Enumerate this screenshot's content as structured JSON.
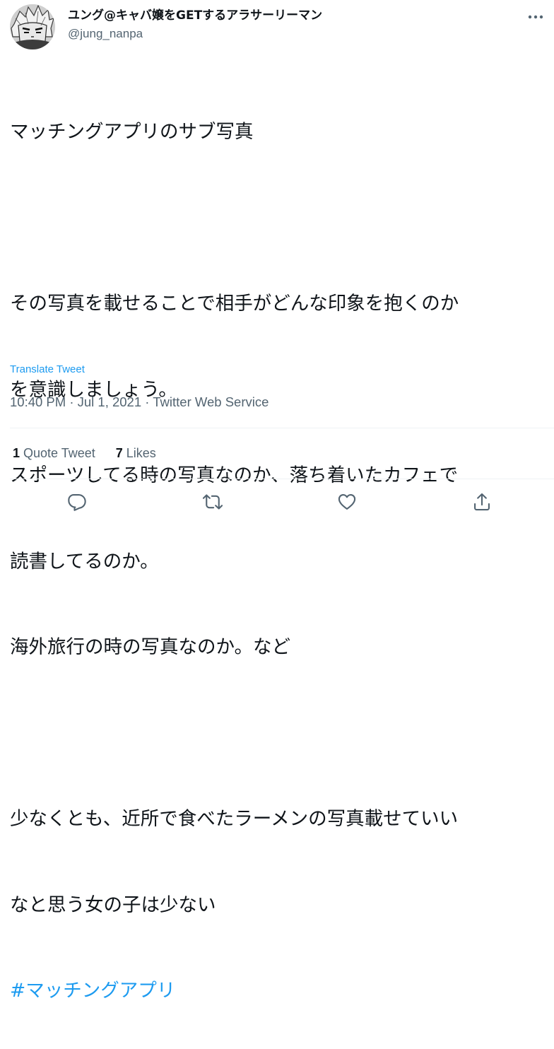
{
  "user": {
    "display_name": "ユング@キャバ嬢をGETするアラサーリーマン",
    "handle": "@jung_nanpa"
  },
  "tweet": {
    "lines": [
      "マッチングアプリのサブ写真",
      "",
      "その写真を載せることで相手がどんな印象を抱くのか",
      "を意識しましょう。",
      "スポーツしてる時の写真なのか、落ち着いたカフェで",
      "読書してるのか。",
      "海外旅行の時の写真なのか。など",
      "",
      "少なくとも、近所で食べたラーメンの写真載せていい",
      "なと思う女の子は少ない"
    ],
    "hashtag": "#マッチングアプリ",
    "translate_label": "Translate Tweet",
    "timestamp": "10:40 PM · Jul 1, 2021 · Twitter Web Service"
  },
  "stats": {
    "quote_count": "1",
    "quote_label": "Quote Tweet",
    "like_count": "7",
    "like_label": "Likes"
  },
  "icons": {
    "reply": "reply-icon",
    "retweet": "retweet-icon",
    "like": "heart-icon",
    "share": "share-icon",
    "more": "more-icon"
  },
  "colors": {
    "text": "#0f1419",
    "secondary": "#536471",
    "link": "#1d9bf0",
    "divider": "#eff3f4"
  }
}
